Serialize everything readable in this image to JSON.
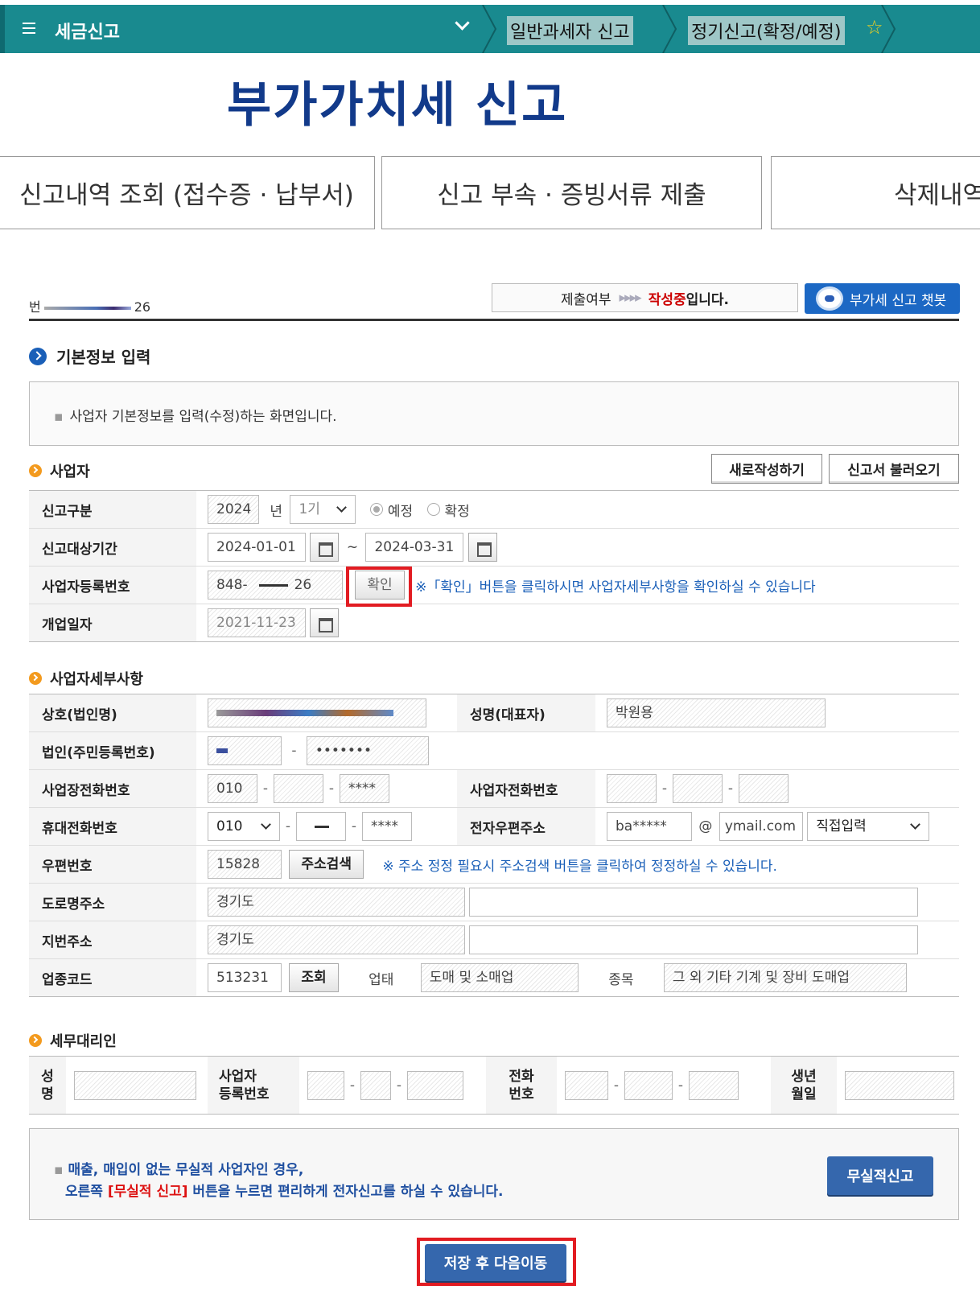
{
  "nav": {
    "title": "세금신고",
    "crumb1": "일반과세자 신고",
    "crumb2": "정기신고(확정/예정)"
  },
  "page_title": "부가가치세 신고",
  "tabs": [
    {
      "label": "신고내역 조회 (접수증 · 납부서)"
    },
    {
      "label": "신고 부속 · 증빙서류 제출"
    },
    {
      "label": "삭제내역"
    }
  ],
  "reg_prefix": "번",
  "reg_suffix": "26",
  "status": {
    "label": "제출여부",
    "arrows": "▸▸▸▸",
    "state": "작성중",
    "tail": "입니다."
  },
  "chatbot_label": "부가세 신고 챗봇",
  "section_title": "기본정보 입력",
  "notice": "사업자 기본정보를 입력(수정)하는 화면입니다.",
  "business": {
    "title": "사업자",
    "new_button": "새로작성하기",
    "load_button": "신고서 불러오기",
    "report_type_label": "신고구분",
    "year": "2024",
    "year_unit": "년",
    "period": "1기",
    "radio_prelim": "예정",
    "radio_final": "확정",
    "period_label": "신고대상기간",
    "from_date": "2024-01-01",
    "tilde": "~",
    "to_date": "2024-03-31",
    "regno_label": "사업자등록번호",
    "regno_a": "848-",
    "regno_b": "26",
    "confirm_button": "확인",
    "confirm_hint": "※「확인」버튼을 클릭하시면 사업자세부사항을 확인하실 수 있습니다",
    "open_date_label": "개업일자",
    "open_date": "2021-11-23"
  },
  "detail": {
    "title": "사업자세부사항",
    "company_label": "상호(법인명)",
    "rep_label": "성명(대표자)",
    "rep_name": "박원용",
    "corp_label": "법인(주민등록번호)",
    "corp_b": "•••••••",
    "biz_phone_label": "사업장전화번호",
    "biz_phone_a": "010",
    "biz_phone_c": "****",
    "owner_phone_label": "사업자전화번호",
    "mobile_label": "휴대전화번호",
    "mobile_a": "010",
    "mobile_c": "****",
    "email_label": "전자우편주소",
    "email_id": "ba*****",
    "at": "@",
    "email_domain": "ymail.com",
    "email_select": "직접입력",
    "zip_label": "우편번호",
    "zip": "15828",
    "addr_search_button": "주소검색",
    "addr_hint": "※ 주소 정정 필요시 주소검색 버튼을 클릭하여 정정하실 수 있습니다.",
    "road_label": "도로명주소",
    "road_addr": "경기도",
    "lot_label": "지번주소",
    "lot_addr": "경기도",
    "code_label": "업종코드",
    "code": "513231",
    "lookup_button": "조회",
    "type_label": "업태",
    "type_value": "도매 및 소매업",
    "item_label": "종목",
    "item_value": "그 외 기타 기계 및 장비 도매업"
  },
  "agent": {
    "title": "세무대리인",
    "name_label_1": "성",
    "name_label_2": "명",
    "reg_label_1": "사업자",
    "reg_label_2": "등록번호",
    "phone_label_1": "전화",
    "phone_label_2": "번호",
    "birth_label_1": "생년",
    "birth_label_2": "월일"
  },
  "bottom": {
    "line1": "매출, 매입이 없는 무실적 사업자인 경우,",
    "line2_pre": "오른쪽 ",
    "line2_red": "[무실적 신고]",
    "line2_post": " 버튼을 누르면 편리하게 전자신고를 하실 수 있습니다.",
    "nil_button": "무실적신고",
    "save_button": "저장 후 다음이동"
  }
}
